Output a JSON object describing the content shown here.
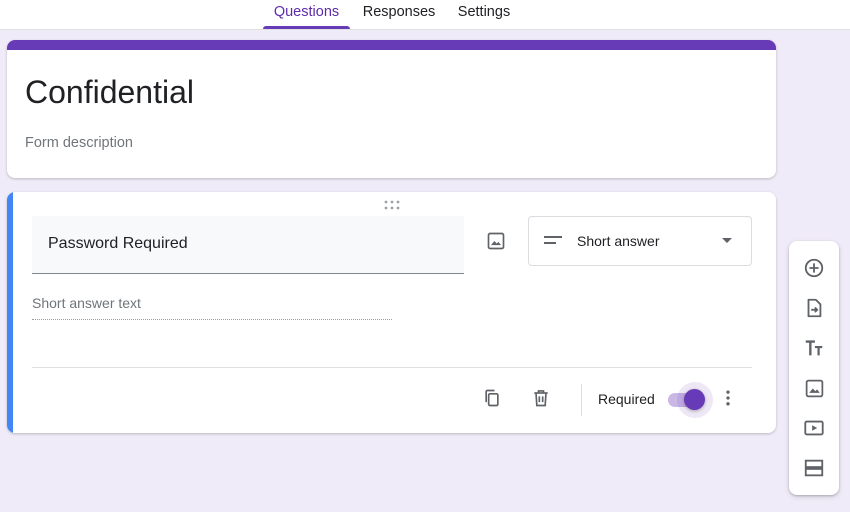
{
  "tabs": [
    {
      "label": "Questions",
      "active": true
    },
    {
      "label": "Responses",
      "active": false
    },
    {
      "label": "Settings",
      "active": false
    }
  ],
  "form": {
    "title": "Confidential",
    "description_placeholder": "Form description"
  },
  "question": {
    "title": "Password Required",
    "type": "Short answer",
    "answer_placeholder": "Short answer text",
    "required_label": "Required",
    "required": true
  },
  "colors": {
    "theme": "#673ab7",
    "background": "#f0ebf8",
    "active_card": "#4285f4"
  },
  "icons": {
    "question_image": "image-icon",
    "type_select": "short-answer-lines-icon",
    "type_caret": "caret-down-icon",
    "duplicate": "copy-icon",
    "delete": "trash-icon",
    "more": "more-vert-icon",
    "drag": "drag-handle-icon",
    "toolbar": [
      "add-circle-icon",
      "import-icon",
      "title-text-icon",
      "image-icon",
      "video-icon",
      "section-icon"
    ]
  }
}
